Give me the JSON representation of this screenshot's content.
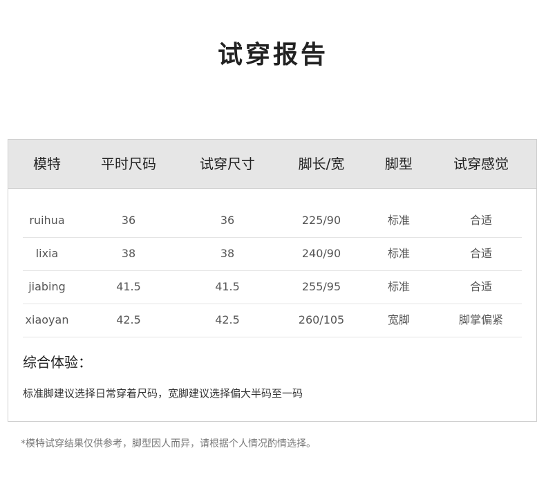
{
  "title": "试穿报告",
  "table": {
    "headers": [
      "模特",
      "平时尺码",
      "试穿尺寸",
      "脚长/宽",
      "脚型",
      "试穿感觉"
    ],
    "rows": [
      [
        "ruihua",
        "36",
        "36",
        "225/90",
        "标准",
        "合适"
      ],
      [
        "lixia",
        "38",
        "38",
        "240/90",
        "标准",
        "合适"
      ],
      [
        "jiabing",
        "41.5",
        "41.5",
        "255/95",
        "标准",
        "合适"
      ],
      [
        "xiaoyan",
        "42.5",
        "42.5",
        "260/105",
        "宽脚",
        "脚掌偏紧"
      ]
    ]
  },
  "summary": {
    "title": "综合体验：",
    "text": "标准脚建议选择日常穿着尺码，宽脚建议选择偏大半码至一码"
  },
  "footnote": "*模特试穿结果仅供参考，脚型因人而异，请根据个人情况酌情选择。"
}
